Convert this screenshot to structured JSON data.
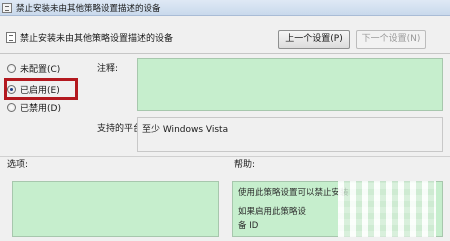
{
  "window": {
    "title": "禁止安装未由其他策略设置描述的设备"
  },
  "header": {
    "policy_name": "禁止安装未由其他策略设置描述的设备",
    "prev_button": "上一个设置(P)",
    "next_button": "下一个设置(N)"
  },
  "state_options": [
    {
      "label": "未配置(C)",
      "selected": false
    },
    {
      "label": "已启用(E)",
      "selected": true
    },
    {
      "label": "已禁用(D)",
      "selected": false
    }
  ],
  "fields": {
    "comment_label": "注释:",
    "comment_value": "",
    "platform_label": "支持的平台:",
    "platform_value": "至少 Windows Vista"
  },
  "panels": {
    "options_label": "选项:",
    "help_label": "帮助:",
    "help_lines": [
      "使用此策略设置可以禁止安装",
      "如果启用此策略设",
      "备 ID"
    ]
  },
  "colors": {
    "field_bg": "#c6eecd",
    "highlight": "#b3191f"
  }
}
